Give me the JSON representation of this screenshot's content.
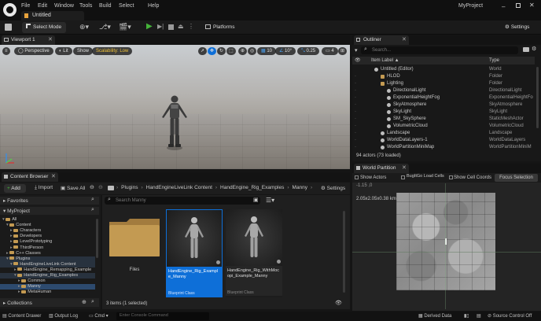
{
  "window": {
    "tab_title": "Untitled",
    "project_name": "MyProject",
    "menu": [
      "File",
      "Edit",
      "Window",
      "Tools",
      "Build",
      "Select",
      "Help"
    ]
  },
  "toolbar": {
    "select_mode": "Select Mode",
    "platforms": "Platforms",
    "settings": "Settings"
  },
  "viewport": {
    "tab_label": "Viewport 1",
    "perspective": "Perspective",
    "lit": "Lit",
    "show": "Show",
    "scalability": "Scalability: Low",
    "grid_snap": "10",
    "rotation_snap": "10°",
    "scale_snap": "0.25",
    "camera_speed": "4"
  },
  "outliner": {
    "tab_label": "Outliner",
    "search_placeholder": "Search...",
    "col_label": "Item Label ▲",
    "col_type": "Type",
    "rows": [
      {
        "label": "Untitled (Editor)",
        "type": "World",
        "depth": 0
      },
      {
        "label": "HLOD",
        "type": "Folder",
        "depth": 1
      },
      {
        "label": "Lighting",
        "type": "Folder",
        "depth": 1
      },
      {
        "label": "DirectionalLight",
        "type": "DirectionalLight",
        "depth": 2
      },
      {
        "label": "ExponentialHeightFog",
        "type": "ExponentialHeightFo",
        "depth": 2
      },
      {
        "label": "SkyAtmosphere",
        "type": "SkyAtmosphere",
        "depth": 2
      },
      {
        "label": "SkyLight",
        "type": "SkyLight",
        "depth": 2
      },
      {
        "label": "SM_SkySphere",
        "type": "StaticMeshActor",
        "depth": 2
      },
      {
        "label": "VolumetricCloud",
        "type": "VolumetricCloud",
        "depth": 2
      },
      {
        "label": "Landscape",
        "type": "Landscape",
        "depth": 1
      },
      {
        "label": "WorldDataLayers-1",
        "type": "WorldDataLayers",
        "depth": 1
      },
      {
        "label": "WorldPartitionMiniMap",
        "type": "WorldPartitionMiniM",
        "depth": 1
      }
    ],
    "footer": "94 actors (73 loaded)"
  },
  "world_partition": {
    "tab_label": "World Partition",
    "show_actors": "Show Actors",
    "bugitgo": "BugItGo Load Cells",
    "show_cell_coords": "Show Cell Coords",
    "focus_selection": "Focus Selection",
    "coord_top": "-1.15 ,0",
    "size_label": "2.05x2.05x0.38 km"
  },
  "content_browser": {
    "tab_label": "Content Browser",
    "add": "Add",
    "import": "Import",
    "save_all": "Save All",
    "settings": "Settings",
    "breadcrumb": [
      "Plugins",
      "HandEngineLiveLink Content",
      "HandEngine_Rig_Examples",
      "Manny"
    ],
    "favorites": "Favorites",
    "project": "MyProject",
    "search_placeholder": "Search Manny",
    "collections": "Collections",
    "status": "3 items (1 selected)",
    "tree": [
      {
        "label": "All",
        "depth": 0
      },
      {
        "label": "Content",
        "depth": 1
      },
      {
        "label": "Characters",
        "depth": 2
      },
      {
        "label": "Developers",
        "depth": 2
      },
      {
        "label": "LevelPrototyping",
        "depth": 2
      },
      {
        "label": "ThirdPerson",
        "depth": 2
      },
      {
        "label": "C++ Classes",
        "depth": 1
      },
      {
        "label": "Plugins",
        "depth": 1
      },
      {
        "label": "HandEngineLiveLink Content",
        "depth": 2
      },
      {
        "label": "HandEngine_Remapping_Example",
        "depth": 3
      },
      {
        "label": "HandEngine_Rig_Examples",
        "depth": 3
      },
      {
        "label": "Common",
        "depth": 4
      },
      {
        "label": "Manny",
        "depth": 4
      },
      {
        "label": "MetaHuman",
        "depth": 4
      }
    ],
    "assets": [
      {
        "name": "Files",
        "type": ""
      },
      {
        "name": "HandEngine_Rig_Example_Manny",
        "type": "Blueprint Class"
      },
      {
        "name": "HandEngine_Rig_WithMocopi_Example_Manny",
        "type": "Blueprint Class"
      }
    ]
  },
  "statusbar": {
    "content_drawer": "Content Drawer",
    "output_log": "Output Log",
    "cmd": "Cmd",
    "console_placeholder": "Enter Console Command",
    "derived_data": "Derived Data",
    "source_control": "Source Control Off"
  },
  "colors": {
    "accent_blue": "#0e6fd8",
    "folder": "#c39a52",
    "scalability": "#f0c23a"
  }
}
